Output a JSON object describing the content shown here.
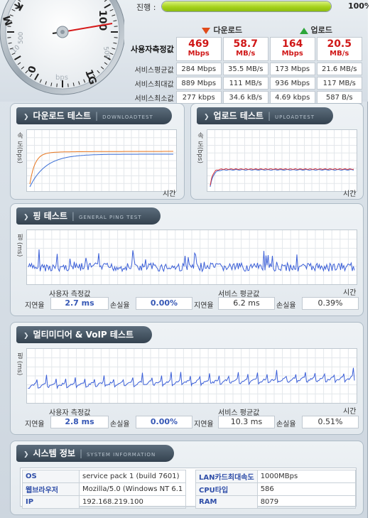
{
  "gauge": {
    "ticks": [
      "0",
      "bps",
      "10",
      "1G",
      "M",
      "100",
      "500",
      "K",
      "500"
    ]
  },
  "progress": {
    "label": "진행 :",
    "percent_text": "100%",
    "fraction": 1.0
  },
  "stats": {
    "download_header": "다운로드",
    "upload_header": "업로드",
    "user_label": "사용자측정값",
    "user": {
      "dl_bps": "469",
      "dl_bps_unit": "Mbps",
      "dl_Bps": "58.7",
      "dl_Bps_unit": "MB/s",
      "ul_bps": "164",
      "ul_bps_unit": "Mbps",
      "ul_Bps": "20.5",
      "ul_Bps_unit": "MB/s"
    },
    "rows": [
      {
        "label": "서비스평균값",
        "dl_bps": "284 Mbps",
        "dl_Bps": "35.5 MB/s",
        "ul_bps": "173 Mbps",
        "ul_Bps": "21.6 MB/s"
      },
      {
        "label": "서비스최대값",
        "dl_bps": "889 Mbps",
        "dl_Bps": "111 MB/s",
        "ul_bps": "936 Mbps",
        "ul_Bps": "117 MB/s"
      },
      {
        "label": "서비스최소값",
        "dl_bps": "277 kbps",
        "dl_Bps": "34.6 kB/s",
        "ul_bps": "4.69 kbps",
        "ul_Bps": "587 B/s"
      }
    ]
  },
  "download_panel": {
    "title": "다운로드 테스트",
    "subtitle": "DOWNLOADTEST",
    "ylabel": "속 도(bps)",
    "xlabel": "시간"
  },
  "upload_panel": {
    "title": "업로드 테스트",
    "subtitle": "UPLOADTEST",
    "ylabel": "속 도(bps)",
    "xlabel": "시간"
  },
  "ping_panel": {
    "title": "핑 테스트",
    "subtitle": "GENERAL PING TEST",
    "ylabel": "핑 (ms)",
    "xlabel": "시간",
    "user_title": "사용자 측정값",
    "service_title": "서비스 평균값",
    "latency_label": "지연율",
    "loss_label": "손실율",
    "user_latency": "2.7 ms",
    "user_loss": "0.00%",
    "service_latency": "6.2 ms",
    "service_loss": "0.39%"
  },
  "voip_panel": {
    "title": "멀티미디어 & VoIP 테스트",
    "subtitle": "",
    "ylabel": "핑 (ms)",
    "xlabel": "시간",
    "user_title": "사용자 측정값",
    "service_title": "서비스 평균값",
    "latency_label": "지연율",
    "loss_label": "손실율",
    "user_latency": "2.8 ms",
    "user_loss": "0.00%",
    "service_latency": "10.3 ms",
    "service_loss": "0.51%"
  },
  "system_panel": {
    "title": "시스템 정보",
    "subtitle": "SYSTEM INFORMATION",
    "left": [
      {
        "key": "OS",
        "value": "service pack 1 (build 7601)"
      },
      {
        "key": "웹브라우저",
        "value": "Mozilla/5.0 (Windows NT 6.1"
      },
      {
        "key": "IP",
        "value": "192.168.219.100"
      }
    ],
    "right": [
      {
        "key": "LAN카드최대속도",
        "value": "1000MBps"
      },
      {
        "key": "CPU타입",
        "value": "586"
      },
      {
        "key": "RAM",
        "value": "8079"
      }
    ]
  },
  "colors": {
    "download_user": "#e8761e",
    "download_avg": "#3b6fd6",
    "upload_user": "#d8323a",
    "upload_avg": "#3b6fd6",
    "ping_line": "#3b5fd8",
    "value_red": "#d01818",
    "value_blue": "#3557b5"
  }
}
